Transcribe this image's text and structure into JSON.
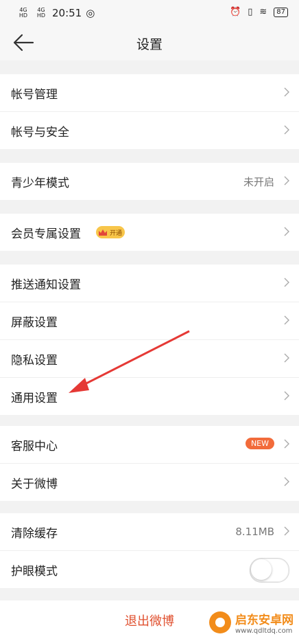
{
  "status_bar": {
    "signal1": "4G HD",
    "signal2": "4G HD",
    "time": "20:51",
    "battery": "87"
  },
  "header": {
    "title": "设置"
  },
  "groups": [
    {
      "items": [
        {
          "label": "帐号管理"
        },
        {
          "label": "帐号与安全"
        }
      ]
    },
    {
      "items": [
        {
          "label": "青少年模式",
          "value": "未开启"
        }
      ]
    },
    {
      "items": [
        {
          "label": "会员专属设置",
          "badge": "开通"
        }
      ]
    },
    {
      "items": [
        {
          "label": "推送通知设置"
        },
        {
          "label": "屏蔽设置"
        },
        {
          "label": "隐私设置"
        },
        {
          "label": "通用设置"
        }
      ]
    },
    {
      "items": [
        {
          "label": "客服中心",
          "badge": "NEW"
        },
        {
          "label": "关于微博"
        }
      ]
    },
    {
      "items": [
        {
          "label": "清除缓存",
          "value": "8.11MB"
        },
        {
          "label": "护眼模式",
          "toggle": false
        }
      ]
    }
  ],
  "logout": {
    "label": "退出微博"
  },
  "watermark": {
    "title": "启东安卓网",
    "url": "www.qdltdq.com"
  },
  "colors": {
    "accent": "#e0502f",
    "new_badge": "#f26b3a",
    "vip_badge": "#f8c64a",
    "arrow": "#e53935"
  }
}
